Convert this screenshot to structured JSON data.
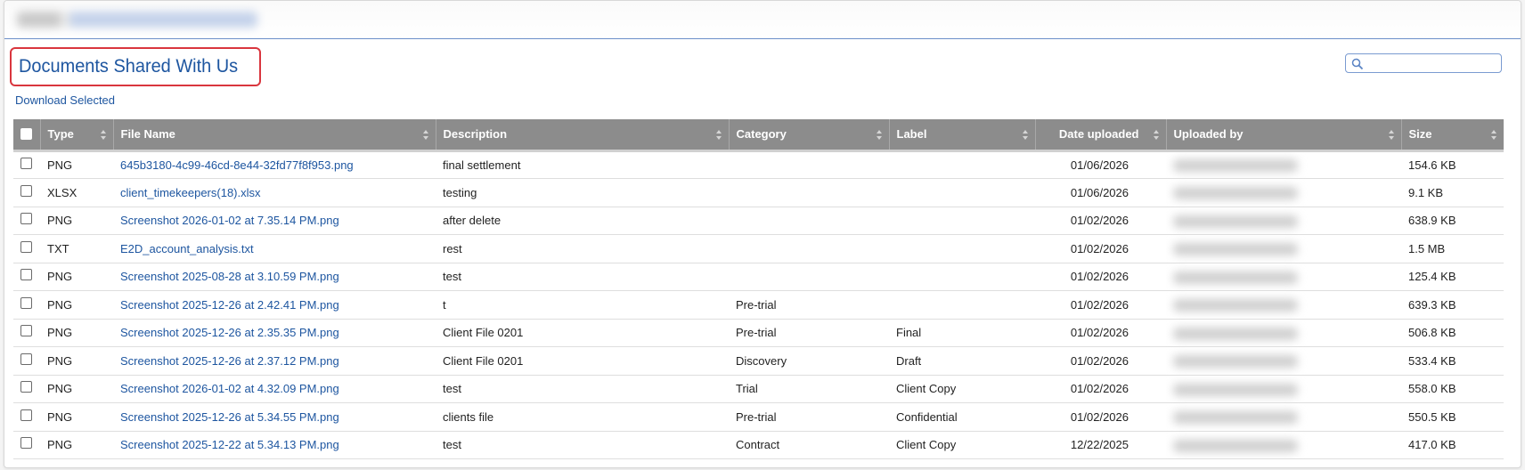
{
  "page": {
    "title": "Documents Shared With Us",
    "download_selected": "Download Selected",
    "search_value": ""
  },
  "colors": {
    "link": "#1e56a0",
    "header_bg": "#8c8c8c",
    "highlight_border": "#d9363e"
  },
  "table": {
    "columns": [
      "Type",
      "File Name",
      "Description",
      "Category",
      "Label",
      "Date uploaded",
      "Uploaded by",
      "Size"
    ],
    "rows": [
      {
        "type": "PNG",
        "file": "645b3180-4c99-46cd-8e44-32fd77f8f953.png",
        "description": "final settlement",
        "category": "",
        "label": "",
        "date": "01/06/2026",
        "size": "154.6 KB"
      },
      {
        "type": "XLSX",
        "file": "client_timekeepers(18).xlsx",
        "description": "testing",
        "category": "",
        "label": "",
        "date": "01/06/2026",
        "size": "9.1 KB"
      },
      {
        "type": "PNG",
        "file": "Screenshot 2026-01-02 at 7.35.14 PM.png",
        "description": "after delete",
        "category": "",
        "label": "",
        "date": "01/02/2026",
        "size": "638.9 KB"
      },
      {
        "type": "TXT",
        "file": "E2D_account_analysis.txt",
        "description": "rest",
        "category": "",
        "label": "",
        "date": "01/02/2026",
        "size": "1.5 MB"
      },
      {
        "type": "PNG",
        "file": "Screenshot 2025-08-28 at 3.10.59 PM.png",
        "description": "test",
        "category": "",
        "label": "",
        "date": "01/02/2026",
        "size": "125.4 KB"
      },
      {
        "type": "PNG",
        "file": "Screenshot 2025-12-26 at 2.42.41 PM.png",
        "description": "t",
        "category": "Pre-trial",
        "label": "",
        "date": "01/02/2026",
        "size": "639.3 KB"
      },
      {
        "type": "PNG",
        "file": "Screenshot 2025-12-26 at 2.35.35 PM.png",
        "description": "Client File 0201",
        "category": "Pre-trial",
        "label": "Final",
        "date": "01/02/2026",
        "size": "506.8 KB"
      },
      {
        "type": "PNG",
        "file": "Screenshot 2025-12-26 at 2.37.12 PM.png",
        "description": "Client File 0201",
        "category": "Discovery",
        "label": "Draft",
        "date": "01/02/2026",
        "size": "533.4 KB"
      },
      {
        "type": "PNG",
        "file": "Screenshot 2026-01-02 at 4.32.09 PM.png",
        "description": "test",
        "category": "Trial",
        "label": "Client Copy",
        "date": "01/02/2026",
        "size": "558.0 KB"
      },
      {
        "type": "PNG",
        "file": "Screenshot 2025-12-26 at 5.34.55 PM.png",
        "description": "clients file",
        "category": "Pre-trial",
        "label": "Confidential",
        "date": "01/02/2026",
        "size": "550.5 KB"
      },
      {
        "type": "PNG",
        "file": "Screenshot 2025-12-22 at 5.34.13 PM.png",
        "description": "test",
        "category": "Contract",
        "label": "Client Copy",
        "date": "12/22/2025",
        "size": "417.0 KB"
      }
    ]
  }
}
